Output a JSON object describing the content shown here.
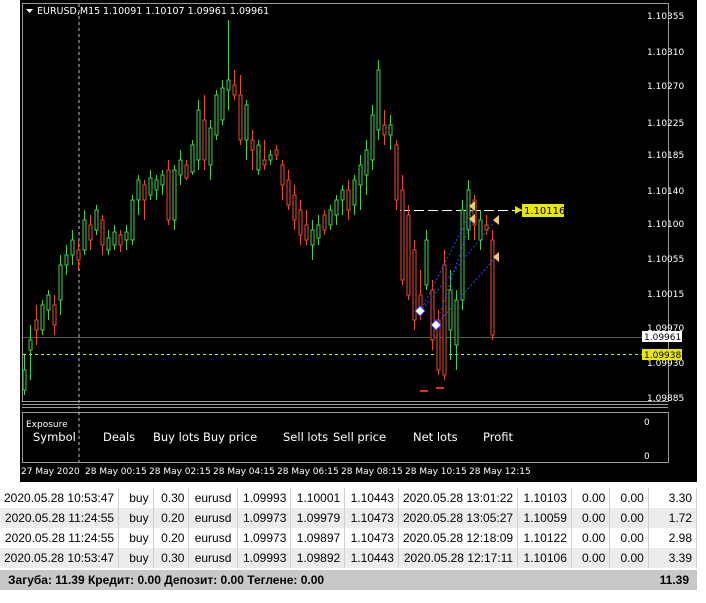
{
  "chart": {
    "title": "EURUSD,M15",
    "ohlc": "1.10091 1.10107 1.09961 1.09961",
    "price_axis": [
      "1.10355",
      "1.10310",
      "1.10270",
      "1.10225",
      "1.10185",
      "1.10140",
      "1.10100",
      "1.10055",
      "1.10015",
      "1.09970",
      "1.09930",
      "1.09885"
    ],
    "bid_price": "1.09961",
    "ask_price": "1.09938",
    "trade_level": "1.10116",
    "time_axis": [
      "27 May 2020",
      "28 May 00:15",
      "28 May 02:15",
      "28 May 04:15",
      "28 May 06:15",
      "28 May 08:15",
      "28 May 10:15",
      "28 May 12:15"
    ],
    "colors": {
      "bull": "#3cd54a",
      "bear": "#ee4a2a",
      "bg": "#000000",
      "ask": "#e8e800"
    }
  },
  "exposure": {
    "title": "Exposure",
    "columns": [
      "Symbol",
      "Deals",
      "Buy lots",
      "Buy price",
      "Sell lots",
      "Sell price",
      "Net lots",
      "Profit"
    ],
    "scale_top": "0",
    "scale_bottom": "0"
  },
  "trades": [
    [
      "2020.05.28 10:53:47",
      "buy",
      "0.30",
      "eurusd",
      "1.09993",
      "1.10001",
      "1.10443",
      "2020.05.28 13:01:22",
      "1.10103",
      "0.00",
      "0.00",
      "3.30"
    ],
    [
      "2020.05.28 11:24:55",
      "buy",
      "0.20",
      "eurusd",
      "1.09973",
      "1.09979",
      "1.10473",
      "2020.05.28 13:05:27",
      "1.10059",
      "0.00",
      "0.00",
      "1.72"
    ],
    [
      "2020.05.28 11:24:55",
      "buy",
      "0.20",
      "eurusd",
      "1.09973",
      "1.09897",
      "1.10473",
      "2020.05.28 12:18:09",
      "1.10122",
      "0.00",
      "0.00",
      "2.98"
    ],
    [
      "2020.05.28 10:53:47",
      "buy",
      "0.30",
      "eurusd",
      "1.09993",
      "1.09892",
      "1.10443",
      "2020.05.28 12:17:11",
      "1.10106",
      "0.00",
      "0.00",
      "3.39"
    ]
  ],
  "summary": {
    "text": "Загуба: 11.39  Кредит: 0.00  Депозит: 0.00  Теглене: 0.00",
    "total": "11.39"
  }
}
